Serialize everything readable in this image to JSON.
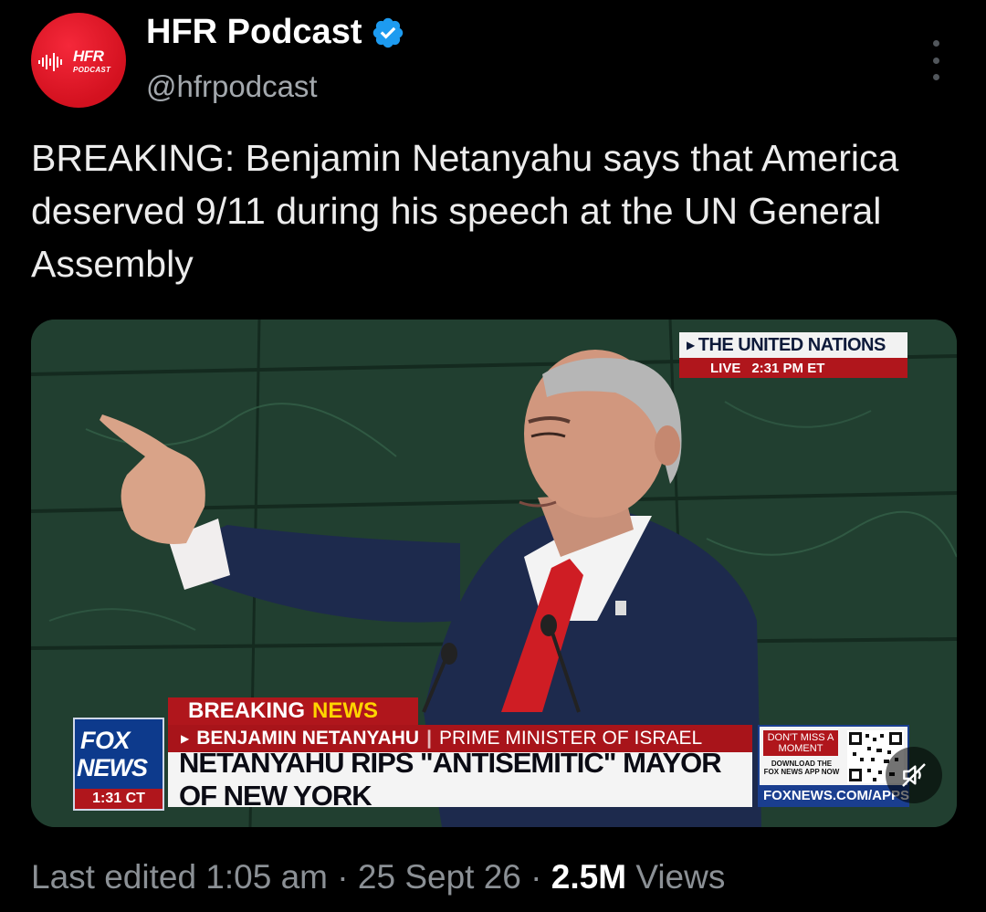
{
  "author": {
    "display_name": "HFR Podcast",
    "handle": "@hfrpodcast",
    "avatar_text_main": "HFR",
    "avatar_text_sub": "PODCAST",
    "verified_icon": "verified-badge-icon",
    "accent": "#1d9bf0",
    "avatar_color": "#e0141f"
  },
  "tweet": {
    "text": "BREAKING: Benjamin Netanyahu says that America deserved 9/11 during his speech at the UN General Assembly"
  },
  "media": {
    "un_tag": {
      "title": "THE UNITED NATIONS",
      "live": "LIVE",
      "time": "2:31 PM ET"
    },
    "fox_logo": {
      "line1": "FOX",
      "line2": "NEWS",
      "time": "1:31 CT"
    },
    "breaking_label": {
      "breaking": "BREAKING",
      "news": "NEWS"
    },
    "subtitle": {
      "name": "BENJAMIN NETANYAHU",
      "role": "PRIME MINISTER OF ISRAEL"
    },
    "headline": "NETANYAHU RIPS \"ANTISEMITIC\" MAYOR OF NEW YORK",
    "promo": {
      "line1": "DON'T MISS A MOMENT",
      "line2": "DOWNLOAD THE FOX NEWS APP NOW",
      "url": "FOXNEWS.COM/APPS"
    },
    "mute_icon": "muted-speaker-icon"
  },
  "footer": {
    "edited": "Last edited 1:05 am",
    "date": "25 Sept 26",
    "views_count": "2.5M",
    "views_label": "Views"
  }
}
